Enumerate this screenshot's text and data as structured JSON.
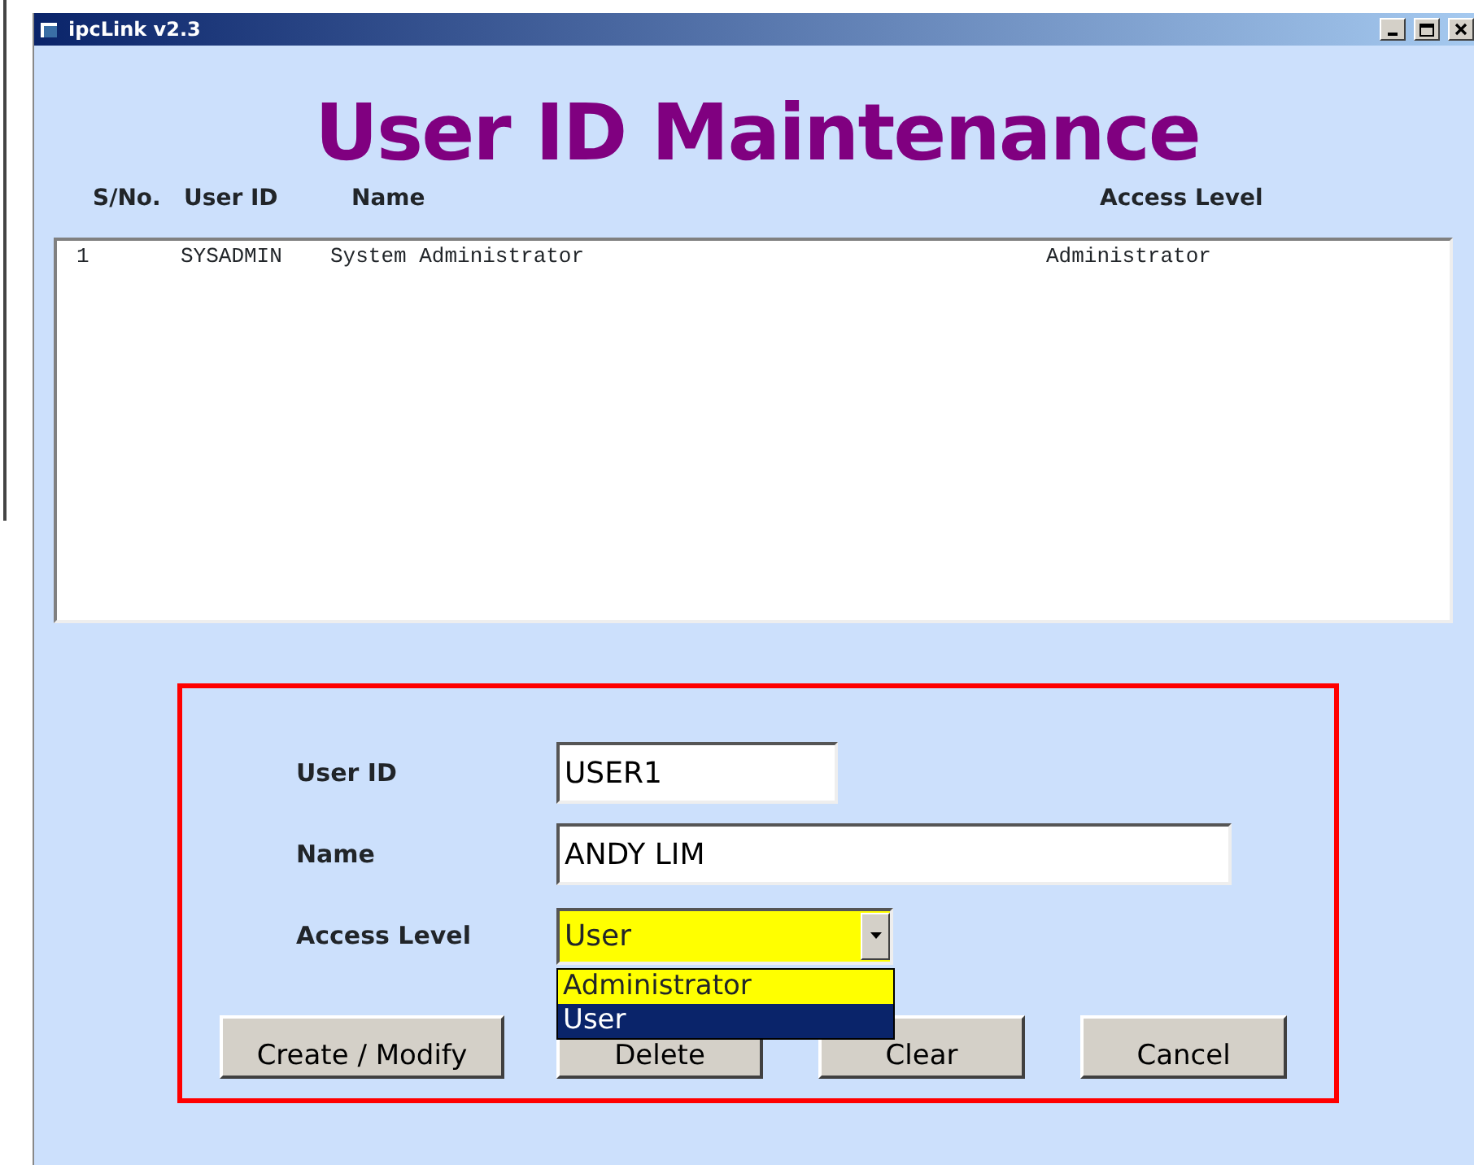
{
  "window": {
    "title": "ipcLink v2.3"
  },
  "heading": "User ID Maintenance",
  "list": {
    "columns": [
      "S/No.",
      "User ID",
      "Name",
      "Access Level"
    ],
    "rows": [
      {
        "cells": [
          "1",
          "SYSADMIN",
          "System Administrator",
          "Administrator"
        ]
      }
    ]
  },
  "form": {
    "fields": [
      {
        "kind": "text",
        "label": "User ID",
        "value": "USER1"
      },
      {
        "kind": "text",
        "label": "Name",
        "value": "ANDY LIM"
      },
      {
        "kind": "combo",
        "label": "Access Level",
        "value": "User",
        "expanded": true,
        "options": [
          {
            "label": "Administrator",
            "selected": false
          },
          {
            "label": "User",
            "selected": true
          }
        ]
      }
    ],
    "buttons": [
      "Create / Modify",
      "Delete",
      "Clear",
      "Cancel"
    ]
  }
}
